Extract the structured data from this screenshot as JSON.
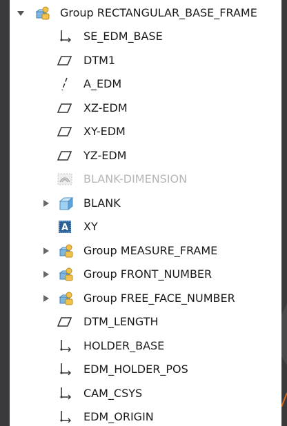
{
  "tree": {
    "root": {
      "label": "Group RECTANGULAR_BASE_FRAME",
      "icon": "group-icon",
      "expanded": true
    },
    "items": [
      {
        "label": "SE_EDM_BASE",
        "icon": "csys-icon"
      },
      {
        "label": "DTM1",
        "icon": "datum-plane-icon"
      },
      {
        "label": "A_EDM",
        "icon": "datum-axis-icon"
      },
      {
        "label": "XZ-EDM",
        "icon": "datum-plane-icon"
      },
      {
        "label": "XY-EDM",
        "icon": "datum-plane-icon"
      },
      {
        "label": "YZ-EDM",
        "icon": "datum-plane-icon"
      },
      {
        "label": "BLANK-DIMENSION",
        "icon": "dimension-icon",
        "disabled": true
      },
      {
        "label": "BLANK",
        "icon": "solid-body-icon",
        "expandable": true
      },
      {
        "label": "XY",
        "icon": "annotation-icon"
      },
      {
        "label": "Group MEASURE_FRAME",
        "icon": "group-icon",
        "expandable": true
      },
      {
        "label": "Group FRONT_NUMBER",
        "icon": "group-icon",
        "expandable": true
      },
      {
        "label": "Group FREE_FACE_NUMBER",
        "icon": "group-icon",
        "expandable": true
      },
      {
        "label": "DTM_LENGTH",
        "icon": "datum-plane-icon"
      },
      {
        "label": "HOLDER_BASE",
        "icon": "csys-icon"
      },
      {
        "label": "EDM_HOLDER_POS",
        "icon": "csys-icon"
      },
      {
        "label": "CAM_CSYS",
        "icon": "csys-icon"
      },
      {
        "label": "EDM_ORIGIN",
        "icon": "csys-icon"
      }
    ]
  }
}
